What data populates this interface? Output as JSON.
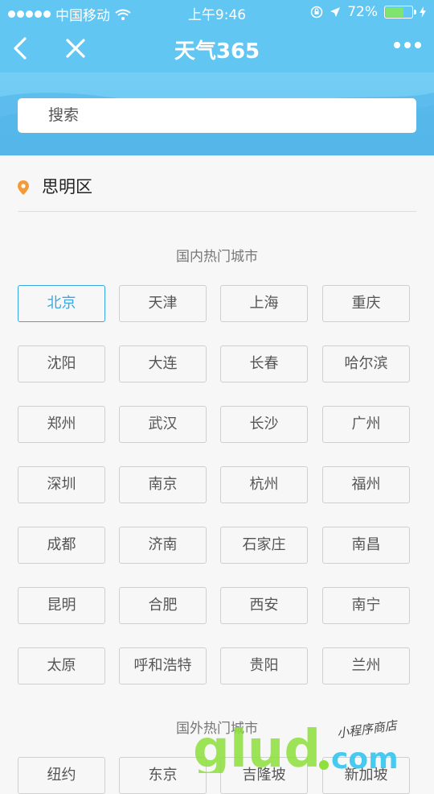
{
  "status_bar": {
    "carrier": "中国移动",
    "time": "上午9:46",
    "battery": "72%",
    "battery_level": 0.72
  },
  "nav": {
    "title": "天气365"
  },
  "search": {
    "placeholder": "搜索"
  },
  "location": {
    "name": "思明区"
  },
  "domestic": {
    "title": "国内热门城市",
    "cities": [
      "北京",
      "天津",
      "上海",
      "重庆",
      "沈阳",
      "大连",
      "长春",
      "哈尔滨",
      "郑州",
      "武汉",
      "长沙",
      "广州",
      "深圳",
      "南京",
      "杭州",
      "福州",
      "成都",
      "济南",
      "石家庄",
      "南昌",
      "昆明",
      "合肥",
      "西安",
      "南宁",
      "太原",
      "呼和浩特",
      "贵阳",
      "兰州"
    ],
    "selected": "北京"
  },
  "foreign": {
    "title": "国外热门城市",
    "cities": [
      "纽约",
      "东京",
      "吉隆坡",
      "新加坡"
    ]
  },
  "watermark": {
    "text": "glud.com",
    "tagline": "小程序商店"
  },
  "colors": {
    "header": "#62c6f3",
    "accent": "#39a8e2",
    "pin": "#f39a3b"
  }
}
